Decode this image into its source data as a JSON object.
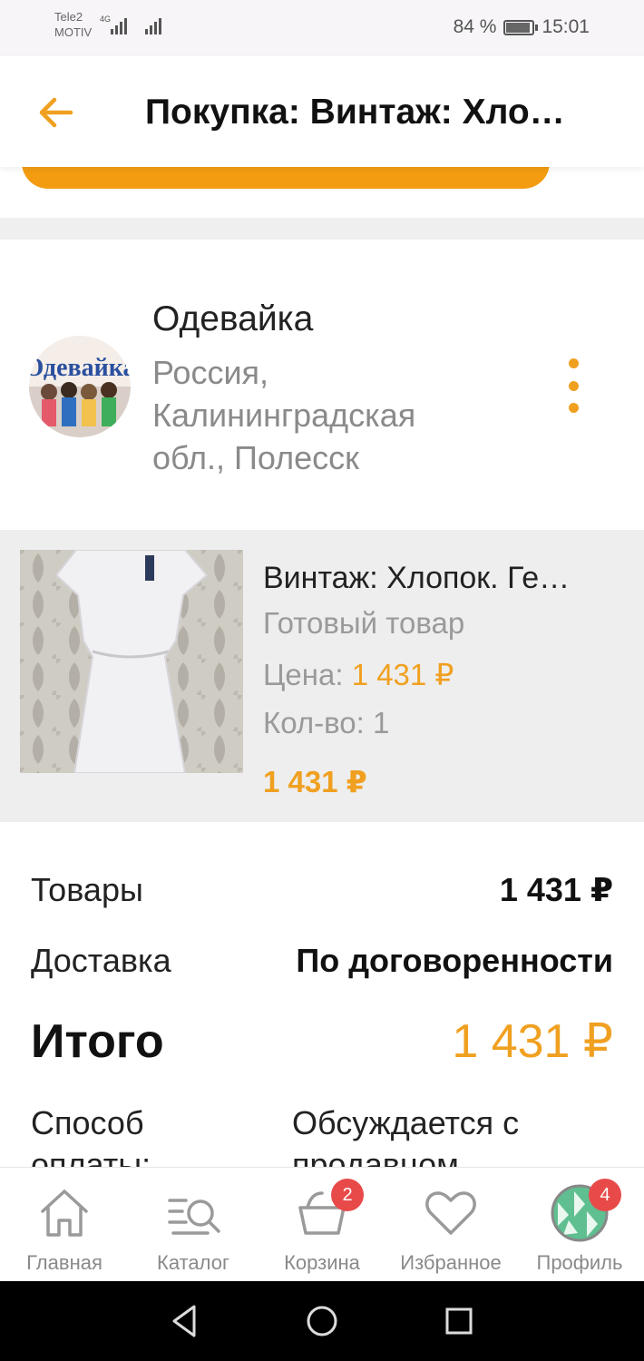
{
  "status_bar": {
    "carrier_line1": "Tele2",
    "carrier_line2": "MOTIV",
    "network": "4G",
    "battery_percent": "84 %",
    "battery_level": 0.84,
    "time": "15:01"
  },
  "header": {
    "title": "Покупка: Винтаж: Хло…",
    "back_icon": "arrow-left-icon"
  },
  "colors": {
    "accent": "#f39c12",
    "accent_text": "#f0a020",
    "badge": "#e84a4a"
  },
  "seller": {
    "name": "Одевайка",
    "location": "Россия, Калининградская обл., Полесск",
    "avatar_text": "Одевайка",
    "menu_icon": "more-vertical-icon"
  },
  "product": {
    "name": "Винтаж: Хлопок. Ге…",
    "type": "Готовый товар",
    "price_label": "Цена:",
    "price_value": "1 431 ₽",
    "qty_label": "Кол-во:",
    "qty_value": "1",
    "total": "1 431 ₽"
  },
  "summary": {
    "goods_label": "Товары",
    "goods_value": "1 431 ₽",
    "delivery_label": "Доставка",
    "delivery_value": "По договоренности",
    "total_label": "Итого",
    "total_value": "1 431 ₽",
    "payment_label": "Способ оплаты:",
    "payment_value": "Обсуждается с продавцом"
  },
  "bottom_nav": {
    "home": {
      "label": "Главная",
      "icon": "home-icon"
    },
    "catalog": {
      "label": "Каталог",
      "icon": "catalog-search-icon"
    },
    "cart": {
      "label": "Корзина",
      "icon": "basket-icon",
      "badge": "2"
    },
    "favorites": {
      "label": "Избранное",
      "icon": "heart-icon"
    },
    "profile": {
      "label": "Профиль",
      "icon": "profile-avatar-icon",
      "badge": "4"
    }
  },
  "system_nav": {
    "back": "back-triangle-icon",
    "home": "home-circle-icon",
    "recents": "recents-square-icon"
  }
}
